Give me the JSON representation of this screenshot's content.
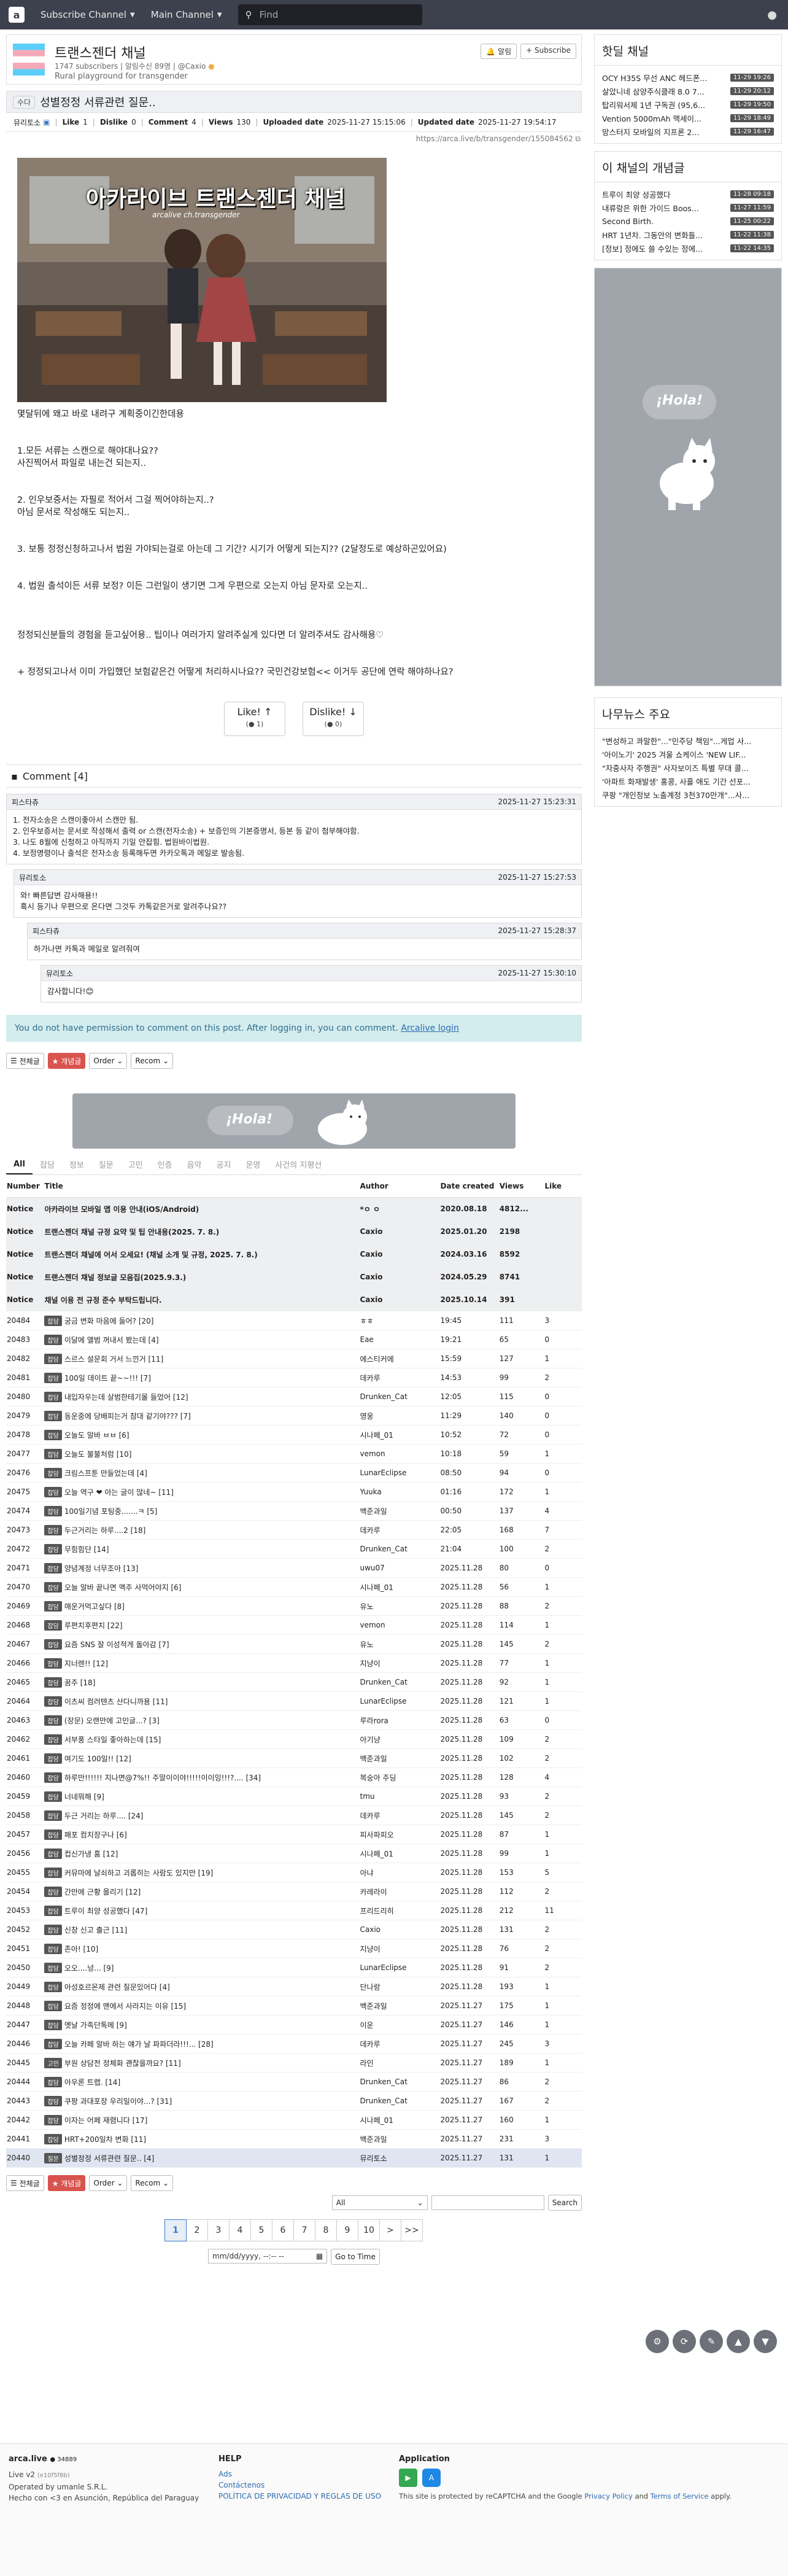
{
  "navbar": {
    "logo": "a",
    "subscribe_channel": "Subscribe Channel",
    "main_channel": "Main Channel",
    "search_placeholder": "Find",
    "user_icon": "user-icon"
  },
  "board": {
    "title": "트랜스젠더 채널",
    "subscribers": "1747 subscribers",
    "meta_mid": "| 알림수신 89명 |",
    "owner": "@Caxio",
    "description": "Rural playground for transgender",
    "btn_alarm": "알림",
    "btn_subscribe": "+ Subscribe"
  },
  "article": {
    "category": "수다",
    "title": "성별정정 서류관련 질문..",
    "author": "뮤리토소",
    "like_label": "Like",
    "like_value": "1",
    "dislike_label": "Dislike",
    "dislike_value": "0",
    "comment_label": "Comment",
    "comment_value": "4",
    "views_label": "Views",
    "views_value": "130",
    "uploaded_label": "Uploaded date",
    "uploaded_value": "2025-11-27 15:15:06",
    "updated_label": "Updated date",
    "updated_value": "2025-11-27 19:54:17",
    "link": "https://arca.live/b/transgender/155084562",
    "image_caption": "아카라이브 트랜스젠더 채널",
    "image_sub": "arcalive ch.transgender",
    "body": [
      "몇달뒤에 왜고 바로 내려구 계획중이긴한데용",
      "",
      "",
      "1.모든 서류는 스캔으로 해야대나요??",
      "사진찍어서 파일로 내는건 되는지..",
      "",
      "",
      "2. 인우보증서는 자필로 적어서 그걸 찍어야하는지..?",
      "아님 문서로 작성해도 되는지..",
      "",
      "",
      "3. 보통 정정신청하고나서 법원 가야되는걸로 아는데 그 기간? 시기가 어떻게 되는지?? (2달정도로 예상하곤있어요)",
      "",
      "",
      "4. 법원 출석이든 서류 보정? 이든 그런일이 생기면 그게 우편으로 오는지 아님 문자로 오는지..",
      "",
      "",
      "",
      "정정되신분들의 경험을 듣고싶어용.. 팁이나 여러가지 알려주실게 있다면 더 알려주셔도 감사해용♡",
      "",
      "",
      "+ 정정되고나서 이미 가입했던 보험같은건 어떻게 처리하시나요?? 국민건강보험<< 이거두 공단에 연락 해야하나요?"
    ],
    "like_btn": "Like! ↑",
    "like_count": "1",
    "dislike_btn": "Dislike! ↓",
    "dislike_count": "0"
  },
  "comments": {
    "header": "Comment [4]",
    "items": [
      {
        "author": "피스타츄",
        "time": "2025-11-27 15:23:31",
        "lines": [
          "1. 전자소송은 스캔이좋아서 스캔만 됨.",
          "2. 인우보증서는 문서로 작성해서 출력 or 스캔(전자소송) + 보증인의 기본증명서, 등본 등 같이 첨부해야함.",
          "3. 나도 8월에 신청하고 아직까지 기일 안잡힘. 법원바이법원.",
          "4. 보정명령이나 출석은 전자소송 등록해두면 카카오톡과 메일로 발송됨."
        ]
      },
      {
        "author": "뮤리토소",
        "time": "2025-11-27 15:27:53",
        "lines": [
          "와! 빠른답변 감사해용!!",
          "혹시 등기나 우편으로 온다면 그것두 카톡같은거로 알려주나요??"
        ]
      },
      {
        "author": "피스타츄",
        "time": "2025-11-27 15:28:37",
        "lines": [
          "하가나면 카톡과 메일로 알려줘여"
        ]
      },
      {
        "author": "뮤리토소",
        "time": "2025-11-27 15:30:10",
        "lines": [
          "감사합니다!😊"
        ]
      }
    ],
    "no_permission": "You do not have permission to comment on this post. After logging in, you can comment.",
    "login_link": "Arcalive login"
  },
  "toolbar": {
    "all": "전체글",
    "best": "★ 개념글",
    "order": "Order",
    "recom": "Recom"
  },
  "banner": {
    "text": "¡Hola!"
  },
  "tabs": [
    "All",
    "잡담",
    "정보",
    "질문",
    "고민",
    "인증",
    "음악",
    "공지",
    "운영",
    "사건의 지평선"
  ],
  "table": {
    "headers": [
      "Number",
      "Title",
      "Author",
      "Date created",
      "Views",
      "Like"
    ],
    "notices": [
      {
        "n": "Notice",
        "t": "아카라이브 모바일 앱 이용 안내(iOS/Android)",
        "a": "*ㅇ ㅇ",
        "d": "2020.08.18",
        "v": "4812...",
        "l": ""
      },
      {
        "n": "Notice",
        "t": "트랜스젠더 채널 규정 요약 및 팁 안내용(2025. 7. 8.)",
        "a": "Caxio",
        "d": "2025.01.20",
        "v": "2198",
        "l": ""
      },
      {
        "n": "Notice",
        "t": "트랜스젠더 채널에 어서 오세요! (채널 소개 및 규정, 2025. 7. 8.)",
        "a": "Caxio",
        "d": "2024.03.16",
        "v": "8592",
        "l": ""
      },
      {
        "n": "Notice",
        "t": "트랜스젠더 채널 정보글 모음집(2025.9.3.)",
        "a": "Caxio",
        "d": "2024.05.29",
        "p": "",
        "v": "8741",
        "l": ""
      },
      {
        "n": "Notice",
        "t": "채널 이용 전 규정 준수 부탁드립니다.",
        "a": "Caxio",
        "d": "2025.10.14",
        "v": "391",
        "l": ""
      }
    ],
    "rows": [
      {
        "n": "20484",
        "c": "잡담",
        "t": "궁금 변화 마음에 들어? [20]",
        "a": "ㅎㅎ",
        "d": "19:45",
        "v": "111",
        "l": "3"
      },
      {
        "n": "20483",
        "c": "잡담",
        "t": "이달에 앨범 꺼내서 봤는데 [4]",
        "a": "Eae",
        "d": "19:21",
        "v": "65",
        "l": "0"
      },
      {
        "n": "20482",
        "c": "잡담",
        "t": "스르스 설문회 거서 느낀거 [11]",
        "a": "에스티커에",
        "d": "15:59",
        "v": "127",
        "l": "1"
      },
      {
        "n": "20481",
        "c": "잡담",
        "t": "100일 데이트 끝~~!!! [7]",
        "a": "데카루",
        "d": "14:53",
        "v": "99",
        "l": "2"
      },
      {
        "n": "20480",
        "c": "잡담",
        "t": "내입자우는데 살범한테기몰 들었어 [12]",
        "a": "Drunken_Cat",
        "d": "12:05",
        "v": "115",
        "l": "0"
      },
      {
        "n": "20479",
        "c": "잡담",
        "t": "동운중에 당배피는거 참대 같기야??? [7]",
        "a": "영웅",
        "d": "11:29",
        "v": "140",
        "l": "0"
      },
      {
        "n": "20478",
        "c": "잡담",
        "t": "오늘도 알바 ㅂㅂ [6]",
        "a": "시나페_01",
        "d": "10:52",
        "v": "72",
        "l": "0"
      },
      {
        "n": "20477",
        "c": "잡담",
        "t": "오늘도 불불처럼 [10]",
        "a": "vemon",
        "d": "10:18",
        "v": "59",
        "l": "1"
      },
      {
        "n": "20476",
        "c": "잡담",
        "t": "크림스프툰 만들었는데 [4]",
        "a": "LunarEclipse",
        "d": "08:50",
        "v": "94",
        "l": "0"
      },
      {
        "n": "20475",
        "c": "잡담",
        "t": "오늘 역구 ❤ 아는 글이 많네~ [11]",
        "a": "Yuuka",
        "d": "01:16",
        "v": "172",
        "l": "1"
      },
      {
        "n": "20474",
        "c": "잡담",
        "t": "100일기념 포팅중.......ㅋ [5]",
        "a": "백준과일",
        "d": "00:50",
        "v": "137",
        "l": "4"
      },
      {
        "n": "20473",
        "c": "잡담",
        "t": "두근거리는 하루....2 [18]",
        "a": "데카루",
        "d": "22:05",
        "v": "168",
        "l": "7"
      },
      {
        "n": "20472",
        "c": "잡담",
        "t": "무힘힘단 [14]",
        "a": "Drunken_Cat",
        "d": "21:04",
        "v": "100",
        "l": "2"
      },
      {
        "n": "20471",
        "c": "잡담",
        "t": "양념계정 너무조아 [13]",
        "a": "uwu07",
        "d": "2025.11.28",
        "v": "80",
        "l": "0"
      },
      {
        "n": "20470",
        "c": "잡담",
        "t": "오늘 알바 끝나면 맥주 사먹어야지 [6]",
        "a": "시나페_01",
        "d": "2025.11.28",
        "v": "56",
        "l": "1"
      },
      {
        "n": "20469",
        "c": "잡담",
        "t": "매운거먹고싶다 [8]",
        "a": "유노",
        "d": "2025.11.28",
        "v": "88",
        "l": "2"
      },
      {
        "n": "20468",
        "c": "잡담",
        "t": "루편치후편치 [22]",
        "a": "vemon",
        "d": "2025.11.28",
        "v": "114",
        "l": "1"
      },
      {
        "n": "20467",
        "c": "잡담",
        "t": "요즘 SNS 잘 이성적게 돌아감 [7]",
        "a": "유노",
        "d": "2025.11.28",
        "v": "145",
        "l": "2"
      },
      {
        "n": "20466",
        "c": "잡담",
        "t": "지너렌!! [12]",
        "a": "지냥이",
        "d": "2025.11.28",
        "v": "77",
        "l": "1"
      },
      {
        "n": "20465",
        "c": "잡담",
        "t": "꿈주 [18]",
        "a": "Drunken_Cat",
        "d": "2025.11.28",
        "v": "92",
        "l": "1"
      },
      {
        "n": "20464",
        "c": "잡담",
        "t": "이츠씨 컴러텐츠 산다니까용 [11]",
        "a": "LunarEclipse",
        "d": "2025.11.28",
        "v": "121",
        "l": "1"
      },
      {
        "n": "20463",
        "c": "잡담",
        "t": "(장문) 오랜만에 고민글...? [3]",
        "a": "루라rora",
        "d": "2025.11.28",
        "v": "63",
        "l": "0"
      },
      {
        "n": "20462",
        "c": "잡담",
        "t": "서부풍 스타일 좋아하는데 [15]",
        "a": "아기냥",
        "d": "2025.11.28",
        "v": "109",
        "l": "2"
      },
      {
        "n": "20461",
        "c": "잡담",
        "t": "여기도 100일!! [12]",
        "a": "백준과일",
        "d": "2025.11.28",
        "v": "102",
        "l": "2"
      },
      {
        "n": "20460",
        "c": "잡담",
        "t": "하루만!!!!!! 지나면@7%!! 주말이이야!!!!!이이잉!!!?.... [34]",
        "a": "복숭아 주딩",
        "d": "2025.11.28",
        "v": "128",
        "l": "4"
      },
      {
        "n": "20459",
        "c": "잡담",
        "t": "너네뭐해 [9]",
        "a": "tmu",
        "d": "2025.11.28",
        "v": "93",
        "l": "2"
      },
      {
        "n": "20458",
        "c": "잡담",
        "t": "두근 거리는 하루.... [24]",
        "a": "데카루",
        "d": "2025.11.28",
        "v": "145",
        "l": "2"
      },
      {
        "n": "20457",
        "c": "잡담",
        "t": "패포 컴치장구나 [6]",
        "a": "피사파피오",
        "d": "2025.11.28",
        "v": "87",
        "l": "1"
      },
      {
        "n": "20456",
        "c": "잡담",
        "t": "컵신가냉 훔 [12]",
        "a": "시나페_01",
        "d": "2025.11.28",
        "v": "99",
        "l": "1"
      },
      {
        "n": "20455",
        "c": "잡담",
        "t": "커뮤마에 날쇠하고 괴롭히는 사람도 있지만 [19]",
        "a": "아냐",
        "d": "2025.11.28",
        "v": "153",
        "l": "5"
      },
      {
        "n": "20454",
        "c": "잡담",
        "t": "간만에 근황 올리기 [12]",
        "a": "카레라이",
        "d": "2025.11.28",
        "v": "112",
        "l": "2"
      },
      {
        "n": "20453",
        "c": "잡담",
        "t": "트루이 최양 성공했다 [47]",
        "a": "프리드리히",
        "d": "2025.11.28",
        "v": "212",
        "l": "11"
      },
      {
        "n": "20452",
        "c": "잡담",
        "t": "신창 신고 출근 [11]",
        "a": "Caxio",
        "d": "2025.11.28",
        "v": "131",
        "l": "2"
      },
      {
        "n": "20451",
        "c": "잡담",
        "t": "존아! [10]",
        "a": "지냥이",
        "d": "2025.11.28",
        "v": "76",
        "l": "2"
      },
      {
        "n": "20450",
        "c": "잡담",
        "t": "오오....넝... [9]",
        "a": "LunarEclipse",
        "d": "2025.11.28",
        "v": "91",
        "l": "2"
      },
      {
        "n": "20449",
        "c": "잡담",
        "t": "아성호르몬제 관련 질문있어다 [4]",
        "a": "단나랑",
        "d": "2025.11.28",
        "v": "193",
        "l": "1"
      },
      {
        "n": "20448",
        "c": "잡담",
        "t": "요즘 정정에 맨에서 사라지는 이유 [15]",
        "a": "백준과일",
        "d": "2025.11.27",
        "v": "175",
        "l": "1"
      },
      {
        "n": "20447",
        "c": "잡담",
        "t": "옛날 가족단톡메 [9]",
        "a": "이운",
        "d": "2025.11.27",
        "v": "146",
        "l": "1"
      },
      {
        "n": "20446",
        "c": "잡담",
        "t": "오늘 카페 알바 하는 얘가 날 파파더라!!!... [28]",
        "a": "데카루",
        "d": "2025.11.27",
        "v": "245",
        "l": "3"
      },
      {
        "n": "20445",
        "c": "고민",
        "t": "부원 상담전 정체화 괜찮을까요? [11]",
        "a": "라인",
        "d": "2025.11.27",
        "v": "189",
        "l": "1"
      },
      {
        "n": "20444",
        "c": "잡담",
        "t": "아우론 트랩. [14]",
        "a": "Drunken_Cat",
        "d": "2025.11.27",
        "v": "86",
        "l": "2"
      },
      {
        "n": "20443",
        "c": "잡담",
        "t": "쿠팡 과대포장 우리일이야...? [31]",
        "a": "Drunken_Cat",
        "d": "2025.11.27",
        "v": "167",
        "l": "2"
      },
      {
        "n": "20442",
        "c": "잡담",
        "t": "이자는 어페 재렴니다 [17]",
        "a": "시나페_01",
        "d": "2025.11.27",
        "v": "160",
        "l": "1"
      },
      {
        "n": "20441",
        "c": "잡담",
        "t": "HRT+200일차 변화 [11]",
        "a": "백준과일",
        "d": "2025.11.27",
        "v": "231",
        "l": "3"
      },
      {
        "n": "20440",
        "c": "질문",
        "t": "성별정정 서류관련 질문.. [4]",
        "a": "뮤리토소",
        "d": "2025.11.27",
        "v": "131",
        "l": "1"
      }
    ]
  },
  "search": {
    "scope": "All",
    "button": "Search"
  },
  "pager": {
    "pages": [
      "1",
      "2",
      "3",
      "4",
      "5",
      "6",
      "7",
      "8",
      "9",
      "10"
    ],
    "next": ">",
    "last": ">>"
  },
  "goto": {
    "date_placeholder": "mm/dd/yyyy, --:-- --",
    "button": "Go to Time"
  },
  "sidebar": {
    "hot_title": "핫딜 채널",
    "hot": [
      {
        "t": "OCY H35S 무선 ANC 헤드폰...",
        "time": "11-29 19:26"
      },
      {
        "t": "살았니네 삼양주식클래 8.0 7...",
        "time": "11-29 20:12"
      },
      {
        "t": "탑리워서제 1년 구독권 (95,6...",
        "time": "11-29 19:50"
      },
      {
        "t": "Vention 5000mAh 맥세이...",
        "time": "11-29 18:49"
      },
      {
        "t": "망스터지 모바일의 지프론 2...",
        "time": "11-29 16:47"
      }
    ],
    "best_title": "이 채널의 개념글",
    "best": [
      {
        "t": "트루이 최양 성공했다",
        "time": "11-28 09:18"
      },
      {
        "t": "내류랑은 위한 가이드 Boos...",
        "time": "11-27 11:59"
      },
      {
        "t": "Second Birth.",
        "time": "11-25 00:22"
      },
      {
        "t": "HRT 1년차. 그동안의 변화들...",
        "time": "11-22 11:38"
      },
      {
        "t": "[정보] 정에도 쓸 수있는 정에...",
        "time": "11-22 14:35"
      }
    ],
    "ad_text": "¡Hola!",
    "news_title": "나무뉴스 주요",
    "news": [
      "\"변성하고 콰말한\"...\"민주당 책임\"...게업 사...",
      "'아이노기' 2025 겨울 쇼케이스 'NEW LIF...",
      "\"자중사자 주행권\" 사자보이즈 특별 무대 콜...",
      "'아파트 화재발생' 홍콩, 사흘 애도 기간 선포...",
      "쿠팡 \"개인정보 노출계정 3천370만개\"...사..."
    ]
  },
  "fabs": [
    "gear-icon",
    "refresh-icon",
    "write-icon",
    "arrow-up-icon",
    "arrow-down-icon"
  ],
  "footer": {
    "brand": "arca.live",
    "brand_count": "34889",
    "version": "Live v2",
    "version_sub": "(e10f5f8b)",
    "operated": "Operated by umanle S.R.L.",
    "made": "Hecho con <3 en Asunción, República del Paraguay",
    "help_title": "HELP",
    "help_links": [
      "Ads",
      "Contáctenos",
      "POLÍTICA DE PRIVACIDAD Y REGLAS DE USO"
    ],
    "app_title": "Application",
    "recaptcha": "This site is protected by reCAPTCHA and the Google",
    "privacy": "Privacy Policy",
    "and": "and",
    "terms": "Terms of Service",
    "apply": "apply."
  },
  "colors": {
    "navbar": "#3d414d",
    "notice_bg": "#eeeff1",
    "info_box": "#d3ecee",
    "cat_bg": "#555555",
    "star_red": "#d9534f"
  }
}
